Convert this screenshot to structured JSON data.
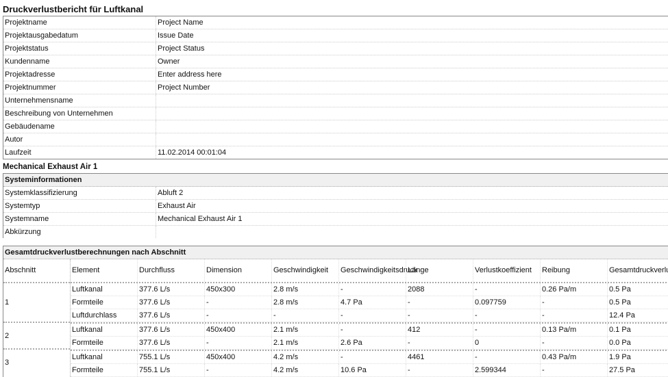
{
  "report_title": "Druckverlustbericht für Luftkanal",
  "project_info": [
    {
      "label": "Projektname",
      "value": "Project Name"
    },
    {
      "label": "Projektausgabedatum",
      "value": "Issue Date"
    },
    {
      "label": "Projektstatus",
      "value": "Project Status"
    },
    {
      "label": "Kundenname",
      "value": "Owner"
    },
    {
      "label": "Projektadresse",
      "value": "Enter address here"
    },
    {
      "label": "Projektnummer",
      "value": "Project Number"
    },
    {
      "label": "Unternehmensname",
      "value": ""
    },
    {
      "label": "Beschreibung von Unternehmen",
      "value": ""
    },
    {
      "label": "Gebäudename",
      "value": ""
    },
    {
      "label": "Autor",
      "value": ""
    },
    {
      "label": "Laufzeit",
      "value": "11.02.2014 00:01:04"
    }
  ],
  "system_title": "Mechanical Exhaust Air 1",
  "system_info": {
    "header": "Systeminformationen",
    "rows": [
      {
        "label": "Systemklassifizierung",
        "value": "Abluft 2"
      },
      {
        "label": "Systemtyp",
        "value": "Exhaust Air"
      },
      {
        "label": "Systemname",
        "value": "Mechanical Exhaust Air 1"
      },
      {
        "label": "Abkürzung",
        "value": ""
      }
    ]
  },
  "sections": {
    "header": "Gesamtdruckverlustberechnungen nach Abschnitt",
    "columns": [
      "Abschnitt",
      "Element",
      "Durchfluss",
      "Dimension",
      "Geschwindigkeit",
      "Geschwindigkeitsdruck",
      "Länge",
      "Verlustkoeffizient",
      "Reibung",
      "Gesamtdruckverlust"
    ],
    "groups": [
      {
        "section": "1",
        "rows": [
          [
            "Luftkanal",
            "377.6 L/s",
            "450x300",
            "2.8 m/s",
            "-",
            "2088",
            "-",
            "0.26 Pa/m",
            "0.5 Pa"
          ],
          [
            "Formteile",
            "377.6 L/s",
            "-",
            "2.8 m/s",
            "4.7 Pa",
            "-",
            "0.097759",
            "-",
            "0.5 Pa"
          ],
          [
            "Luftdurchlass",
            "377.6 L/s",
            "-",
            "-",
            "-",
            "-",
            "-",
            "-",
            "12.4 Pa"
          ]
        ]
      },
      {
        "section": "2",
        "rows": [
          [
            "Luftkanal",
            "377.6 L/s",
            "450x400",
            "2.1 m/s",
            "-",
            "412",
            "-",
            "0.13 Pa/m",
            "0.1 Pa"
          ],
          [
            "Formteile",
            "377.6 L/s",
            "-",
            "2.1 m/s",
            "2.6 Pa",
            "-",
            "0",
            "-",
            "0.0 Pa"
          ]
        ]
      },
      {
        "section": "3",
        "rows": [
          [
            "Luftkanal",
            "755.1 L/s",
            "450x400",
            "4.2 m/s",
            "-",
            "4461",
            "-",
            "0.43 Pa/m",
            "1.9 Pa"
          ],
          [
            "Formteile",
            "755.1 L/s",
            "-",
            "4.2 m/s",
            "10.6 Pa",
            "-",
            "2.599344",
            "-",
            "27.5 Pa"
          ]
        ]
      }
    ]
  }
}
